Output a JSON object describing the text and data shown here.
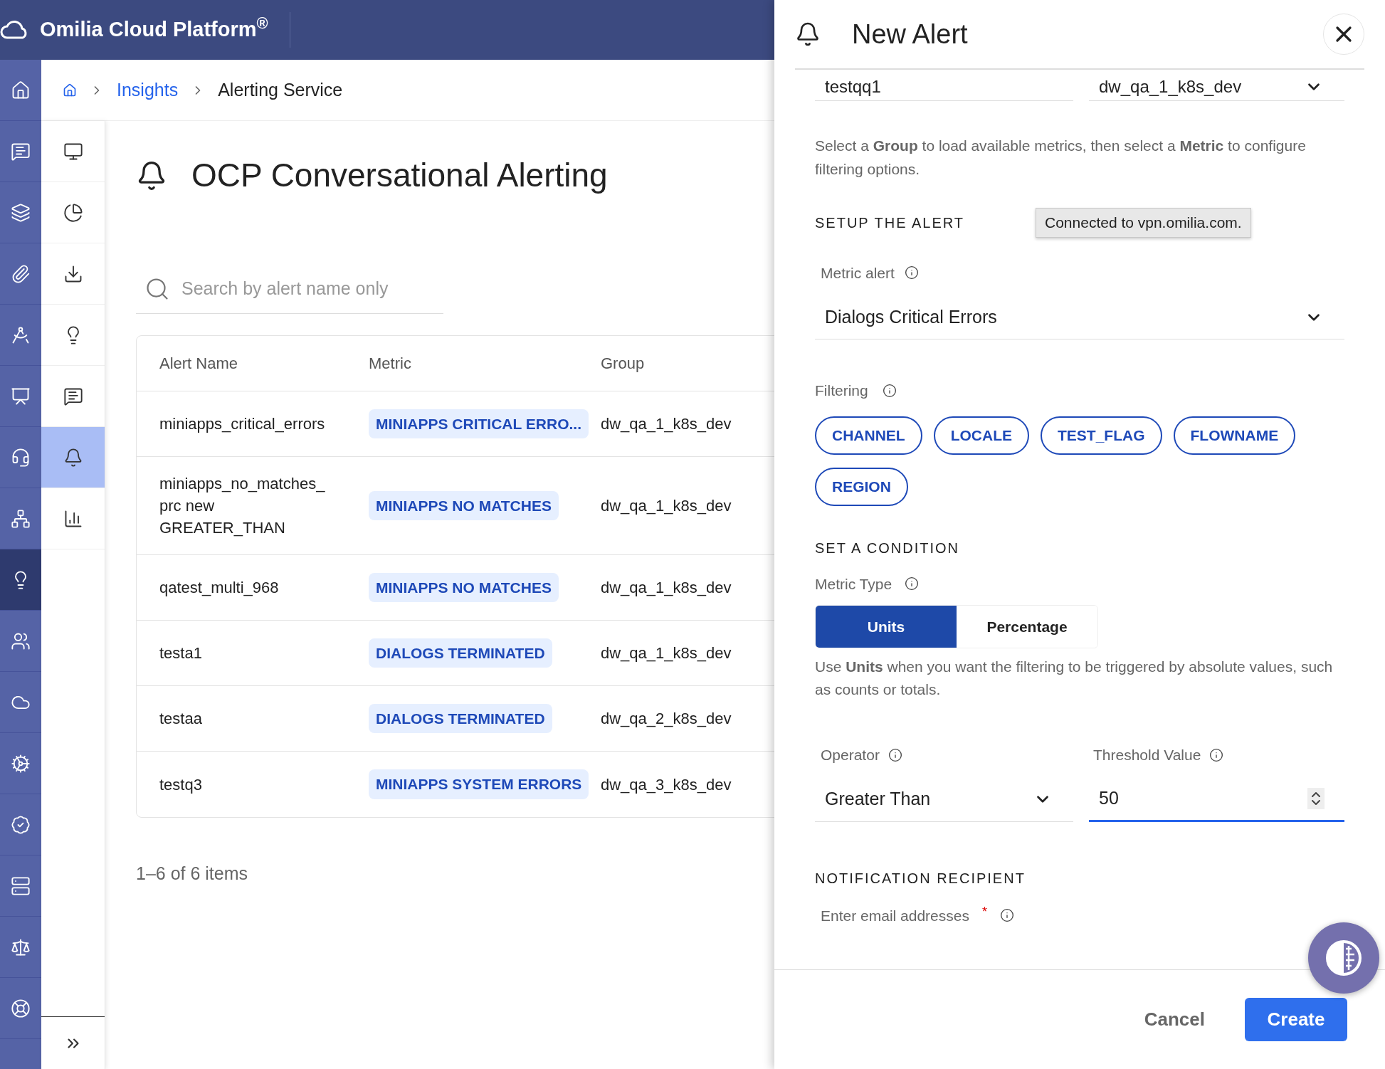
{
  "app": {
    "title": "Omilia Cloud Platform$^{®}$"
  },
  "rail": {
    "items": [
      {
        "kind": "home",
        "selected": false
      },
      {
        "kind": "chat",
        "selected": false
      },
      {
        "kind": "layers",
        "selected": false
      },
      {
        "kind": "clip",
        "selected": false
      },
      {
        "kind": "compass",
        "selected": false
      },
      {
        "kind": "presentation",
        "selected": false
      },
      {
        "kind": "headset",
        "selected": false
      },
      {
        "kind": "network",
        "selected": false
      },
      {
        "kind": "bulb",
        "selected": true
      },
      {
        "kind": "users",
        "selected": false
      },
      {
        "kind": "cloud",
        "selected": false
      },
      {
        "kind": "cog",
        "selected": false
      },
      {
        "kind": "badge",
        "selected": false
      },
      {
        "kind": "server",
        "selected": false
      },
      {
        "kind": "scale",
        "selected": false
      },
      {
        "kind": "lifebuoy",
        "selected": false
      }
    ]
  },
  "breadcrumb": {
    "items": [
      "Insights",
      "Alerting Service"
    ]
  },
  "subnav": {
    "items": [
      {
        "kind": "monitor",
        "selected": false
      },
      {
        "kind": "pie",
        "selected": false
      },
      {
        "kind": "download",
        "selected": false
      },
      {
        "kind": "bulb",
        "selected": false
      },
      {
        "kind": "chat",
        "selected": false
      },
      {
        "kind": "bell",
        "selected": true
      },
      {
        "kind": "bars",
        "selected": false
      }
    ]
  },
  "page": {
    "title": "OCP Conversational Alerting"
  },
  "search": {
    "placeholder": "Search by alert name only"
  },
  "table": {
    "columns": [
      "Alert Name",
      "Metric",
      "Group"
    ],
    "rows": [
      {
        "alert_name": "miniapps_critical_errors",
        "metric": "MINIAPPS CRITICAL ERRO...",
        "group": "dw_qa_1_k8s_dev"
      },
      {
        "alert_name": "miniapps_no_matches_\nprc new\nGREATER_THAN",
        "metric": "MINIAPPS NO MATCHES",
        "group": "dw_qa_1_k8s_dev"
      },
      {
        "alert_name": "qatest_multi_968",
        "metric": "MINIAPPS NO MATCHES",
        "group": "dw_qa_1_k8s_dev"
      },
      {
        "alert_name": "testa1",
        "metric": "DIALOGS TERMINATED",
        "group": "dw_qa_1_k8s_dev"
      },
      {
        "alert_name": "testaa",
        "metric": "DIALOGS TERMINATED",
        "group": "dw_qa_2_k8s_dev"
      },
      {
        "alert_name": "testq3",
        "metric": "MINIAPPS SYSTEM ERRORS",
        "group": "dw_qa_3_k8s_dev"
      }
    ]
  },
  "pagination": "1–6 of 6 items",
  "panel": {
    "title": "New Alert",
    "name_value": "testqq1",
    "group_value": "dw_qa_1_k8s_dev",
    "hint": "Select a **Group** to load available metrics, then select a **Metric** to configure filtering options.",
    "setup_heading": "SETUP THE ALERT",
    "tooltip": "Connected to vpn.omilia.com.",
    "metric_alert": {
      "label": "Metric alert",
      "value": "Dialogs Critical Errors"
    },
    "filtering": {
      "label": "Filtering",
      "chips": [
        "CHANNEL",
        "LOCALE",
        "TEST_FLAG",
        "FLOWNAME",
        "REGION"
      ]
    },
    "condition_heading": "SET A CONDITION",
    "metric_type": {
      "label": "Metric Type",
      "options": [
        {
          "label": "Units",
          "selected": true
        },
        {
          "label": "Percentage",
          "selected": false
        }
      ]
    },
    "metric_type_hint": "Use **Units** when you want the filtering to be triggered by absolute values, such as counts or totals.",
    "operator": {
      "label": "Operator",
      "value": "Greater Than"
    },
    "threshold": {
      "label": "Threshold Value",
      "value": "50"
    },
    "recipient_heading": "NOTIFICATION RECIPIENT",
    "email": {
      "label": "Enter email addresses",
      "required": "*"
    },
    "buttons": {
      "cancel": "Cancel",
      "create": "Create"
    }
  }
}
